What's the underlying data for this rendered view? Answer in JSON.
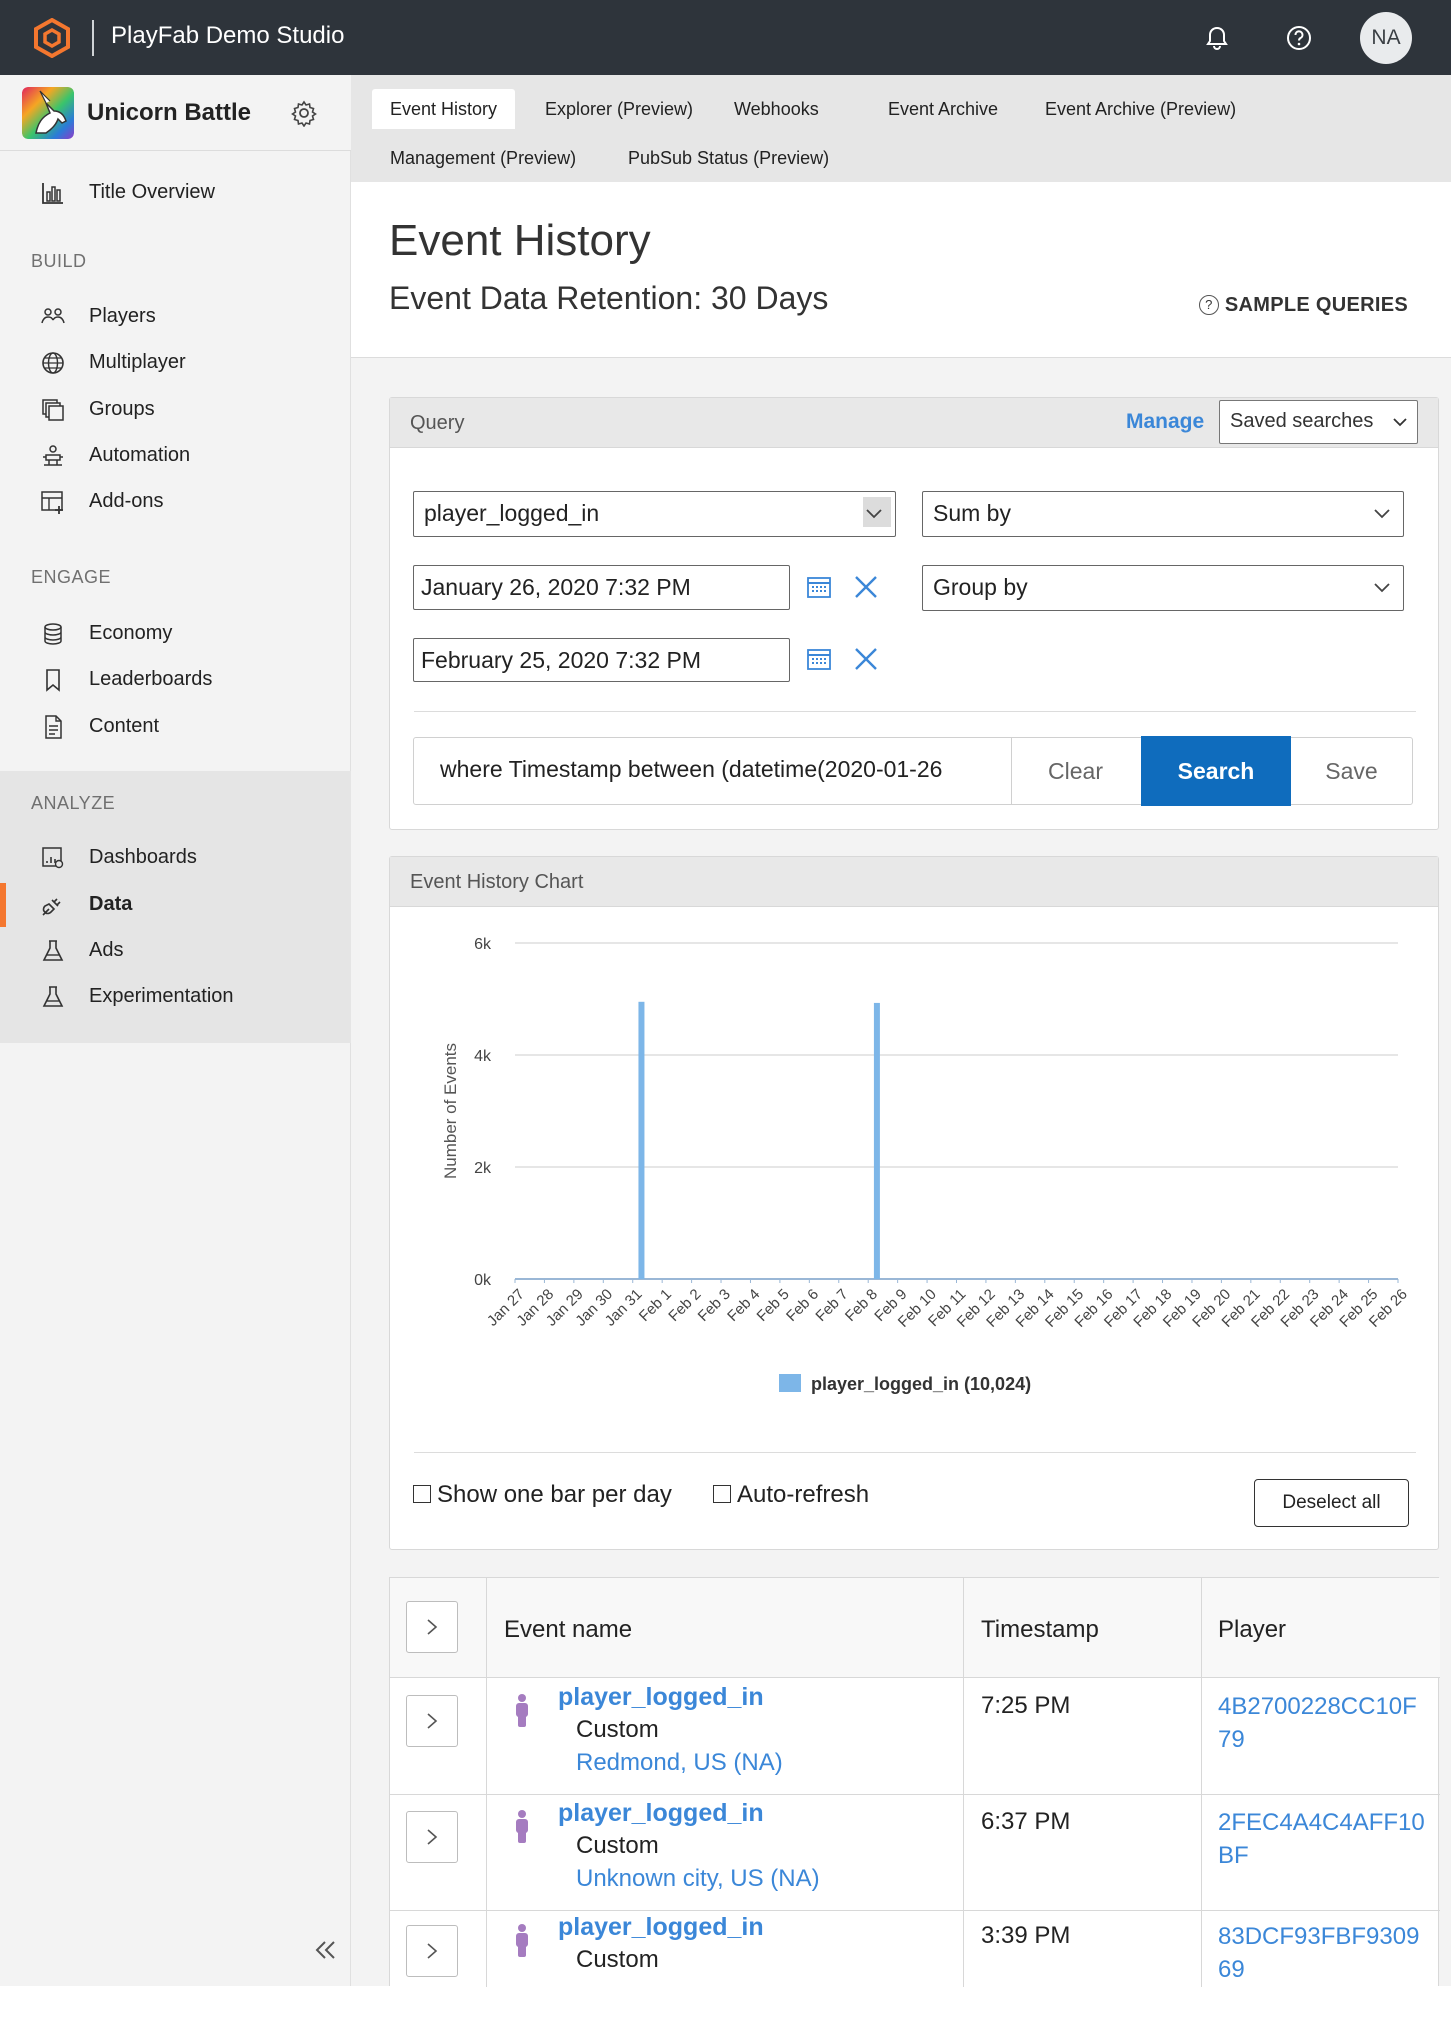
{
  "topbar": {
    "studio_name": "PlayFab Demo Studio",
    "avatar_initials": "NA"
  },
  "sidebar": {
    "game_title": "Unicorn Battle",
    "title_overview": "Title Overview",
    "sections": {
      "build": "BUILD",
      "engage": "ENGAGE",
      "analyze": "ANALYZE"
    },
    "build_items": [
      "Players",
      "Multiplayer",
      "Groups",
      "Automation",
      "Add-ons"
    ],
    "engage_items": [
      "Economy",
      "Leaderboards",
      "Content"
    ],
    "analyze_items": [
      "Dashboards",
      "Data",
      "Ads",
      "Experimentation"
    ],
    "active_item": "Data"
  },
  "tabs": [
    "Event History",
    "Explorer (Preview)",
    "Webhooks",
    "Event Archive",
    "Event Archive (Preview)",
    "Management (Preview)",
    "PubSub Status (Preview)"
  ],
  "page": {
    "title": "Event History",
    "retention": "Event Data Retention: 30 Days",
    "sample_queries": "SAMPLE QUERIES"
  },
  "query": {
    "header": "Query",
    "manage": "Manage",
    "saved_searches": "Saved searches",
    "event_select": "player_logged_in",
    "sum_by": "Sum by",
    "group_by": "Group by",
    "start_date": "January 26, 2020 7:32 PM",
    "end_date": "February 25, 2020 7:32 PM",
    "query_text": "where Timestamp between (datetime(2020-01-26",
    "clear": "Clear",
    "search": "Search",
    "save": "Save"
  },
  "chart_section": {
    "header": "Event History Chart",
    "show_one_bar": "Show one bar per day",
    "auto_refresh": "Auto-refresh",
    "deselect_all": "Deselect all"
  },
  "chart_data": {
    "type": "bar",
    "ylabel": "Number of Events",
    "ylim": [
      0,
      6000
    ],
    "yticks": [
      "0k",
      "2k",
      "4k",
      "6k"
    ],
    "ytick_values": [
      0,
      2000,
      4000,
      6000
    ],
    "categories": [
      "Jan 27",
      "Jan 28",
      "Jan 29",
      "Jan 30",
      "Jan 31",
      "Feb 1",
      "Feb 2",
      "Feb 3",
      "Feb 4",
      "Feb 5",
      "Feb 6",
      "Feb 7",
      "Feb 8",
      "Feb 9",
      "Feb 10",
      "Feb 11",
      "Feb 12",
      "Feb 13",
      "Feb 14",
      "Feb 15",
      "Feb 16",
      "Feb 17",
      "Feb 18",
      "Feb 19",
      "Feb 20",
      "Feb 21",
      "Feb 22",
      "Feb 23",
      "Feb 24",
      "Feb 25",
      "Feb 26"
    ],
    "series": [
      {
        "name": "player_logged_in (10,024)",
        "color": "#7db6e8",
        "values": [
          0,
          0,
          0,
          0,
          4950,
          0,
          0,
          0,
          0,
          0,
          0,
          0,
          4930,
          0,
          0,
          0,
          0,
          0,
          0,
          0,
          0,
          0,
          0,
          0,
          0,
          0,
          0,
          0,
          0,
          0,
          0
        ]
      }
    ],
    "grid": true,
    "legend": "bottom-center"
  },
  "table": {
    "headers": {
      "event_name": "Event name",
      "timestamp": "Timestamp",
      "player": "Player"
    },
    "rows": [
      {
        "name": "player_logged_in",
        "type": "Custom",
        "location": "Redmond, US (NA)",
        "timestamp": "7:25 PM",
        "player": "4B2700228CC10F79"
      },
      {
        "name": "player_logged_in",
        "type": "Custom",
        "location": "Unknown city, US (NA)",
        "timestamp": "6:37 PM",
        "player": "2FEC4A4C4AFF10BF"
      },
      {
        "name": "player_logged_in",
        "type": "Custom",
        "location": "",
        "timestamp": "3:39 PM",
        "player": "83DCF93FBF930969"
      }
    ]
  },
  "colors": {
    "accent": "#f4772f",
    "link": "#3b87d8",
    "primary_button": "#0f6cbd",
    "topbar": "#2e343b"
  }
}
